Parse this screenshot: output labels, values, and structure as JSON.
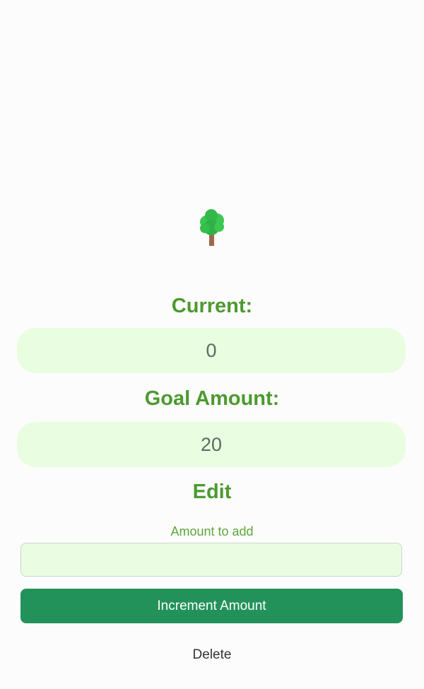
{
  "tree_icon": "tree-emoji",
  "current": {
    "label": "Current:",
    "value": "0"
  },
  "goal": {
    "label": "Goal Amount:",
    "value": "20"
  },
  "edit": {
    "heading": "Edit",
    "amount_label": "Amount to add",
    "amount_value": "",
    "increment_label": "Increment Amount",
    "delete_label": "Delete"
  },
  "colors": {
    "accent_green": "#4c9a2f",
    "button_green": "#23925a",
    "field_background": "#e9fde1"
  }
}
